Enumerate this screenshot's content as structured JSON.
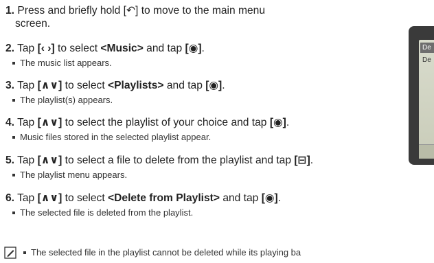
{
  "steps": [
    {
      "num": "1.",
      "lines": [
        "Press and briefly hold [↶] to move to the main menu",
        "screen."
      ]
    },
    {
      "num": "2.",
      "text_a": "Tap ",
      "btn_a": "[‹ ›]",
      "text_b": " to select ",
      "target": "<Music>",
      "text_c": " and tap ",
      "btn_b": "[◉]",
      "text_d": ".",
      "sub": "The music list appears."
    },
    {
      "num": "3.",
      "text_a": "Tap ",
      "btn_a": "[∧∨]",
      "text_b": " to select ",
      "target": "<Playlists>",
      "text_c": " and tap ",
      "btn_b": "[◉]",
      "text_d": ".",
      "sub": "The playlist(s) appears."
    },
    {
      "num": "4.",
      "text_a": "Tap ",
      "btn_a": "[∧∨]",
      "text_b": " to select the playlist of your choice and tap ",
      "btn_b": "[◉]",
      "text_c": ".",
      "sub": "Music files stored in the selected playlist appear."
    },
    {
      "num": "5.",
      "text_a": "Tap ",
      "btn_a": "[∧∨]",
      "text_b": " to select a file to delete from the playlist and tap ",
      "btn_b": "[⊟]",
      "text_c": ".",
      "sub": "The playlist menu appears."
    },
    {
      "num": "6.",
      "text_a": "Tap ",
      "btn_a": "[∧∨]",
      "text_b": " to select ",
      "target": "<Delete from Playlist>",
      "text_c": " and tap ",
      "btn_b": "[◉]",
      "text_d": ".",
      "sub": "The selected file is deleted from the playlist."
    }
  ],
  "note": "The selected file in the playlist cannot be deleted while its playing ba",
  "device": {
    "title": "De",
    "item": "De"
  },
  "icons": {
    "note": "note-pencil-icon"
  }
}
